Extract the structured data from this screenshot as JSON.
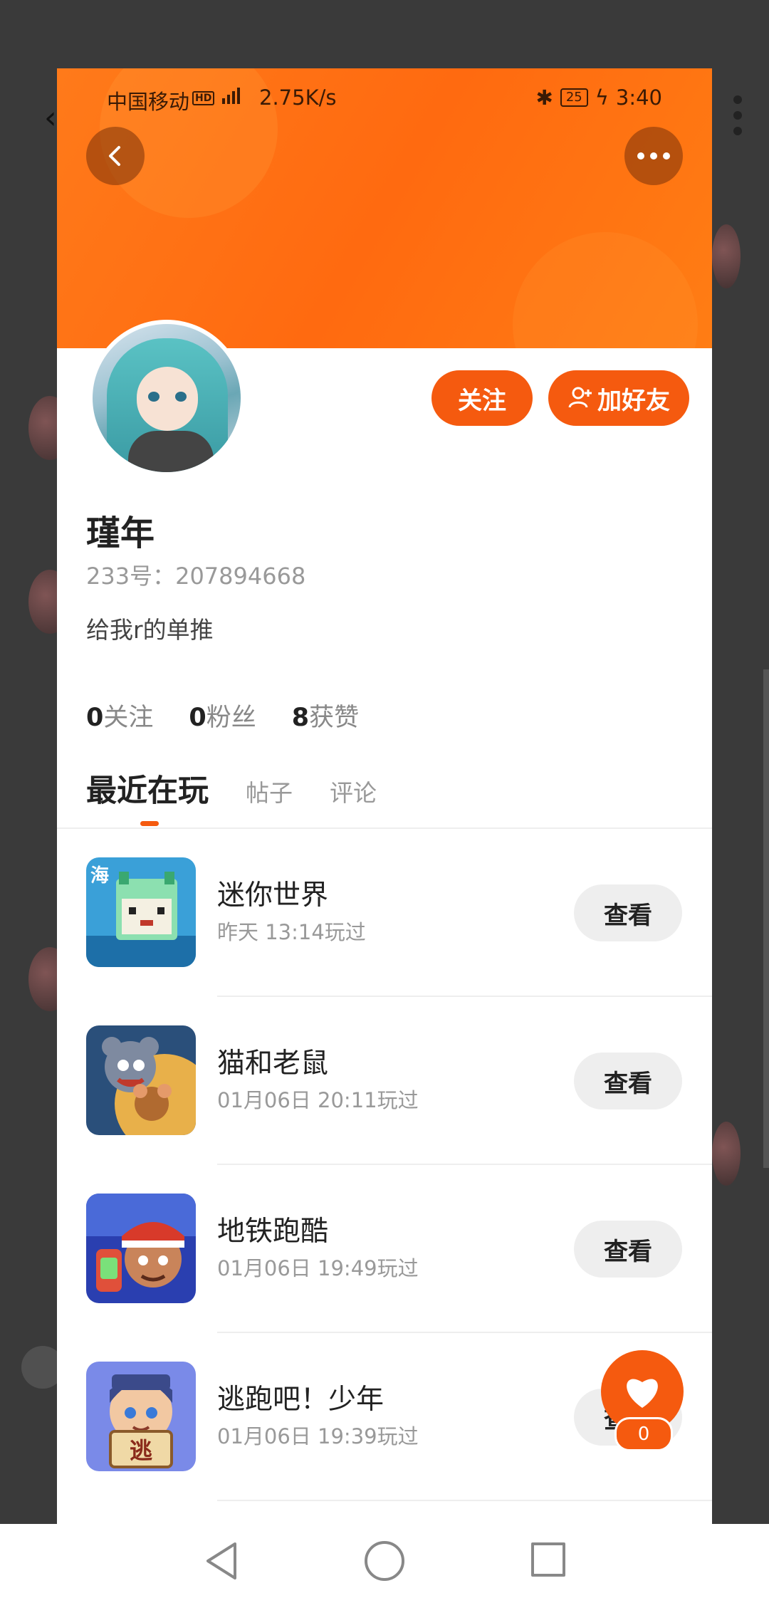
{
  "status_bar": {
    "carrier": "中国移动",
    "hd": "HD",
    "speed": "2.75K/s",
    "battery": "25",
    "time": "3:40"
  },
  "profile": {
    "name": "瑾年",
    "uid": "233号：207894668",
    "bio": "给我r的单推",
    "follow_label": "关注",
    "add_friend_label": "加好友"
  },
  "stats": [
    {
      "value": "0",
      "label": "关注"
    },
    {
      "value": "0",
      "label": "粉丝"
    },
    {
      "value": "8",
      "label": "获赞"
    }
  ],
  "tabs": [
    {
      "label": "最近在玩",
      "active": true
    },
    {
      "label": "帖子"
    },
    {
      "label": "评论"
    }
  ],
  "games": [
    {
      "title": "迷你世界",
      "time": "昨天 13:14玩过",
      "button": "查看"
    },
    {
      "title": "猫和老鼠",
      "time": "01月06日 20:11玩过",
      "button": "查看"
    },
    {
      "title": "地铁跑酷",
      "time": "01月06日 19:49玩过",
      "button": "查看"
    },
    {
      "title": "逃跑吧！少年",
      "time": "01月06日 19:39玩过",
      "button": "查看",
      "icon_text": "逃"
    }
  ],
  "like_fab": {
    "count": "0"
  },
  "colors": {
    "accent": "#f55a0f",
    "header": "#ff7a1a"
  }
}
